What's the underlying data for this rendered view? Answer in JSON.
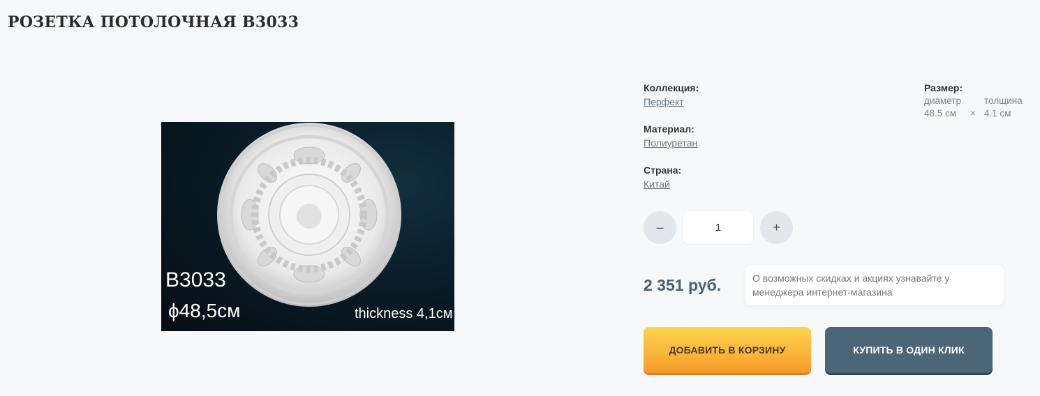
{
  "title": "РОЗЕТКА ПОТОЛОЧНАЯ B3033",
  "image": {
    "code": "B3033",
    "diameter": "ϕ48,5см",
    "thickness": "thickness 4,1см"
  },
  "attributes": [
    {
      "label": "Коллекция:",
      "value": "Перфект"
    },
    {
      "label": "Материал:",
      "value": "Полиуретан"
    },
    {
      "label": "Страна:",
      "value": "Китай"
    }
  ],
  "size": {
    "label": "Размер:",
    "diameter_label": "диаметр",
    "thickness_label": "толщина",
    "diameter_value": "48.5 см",
    "separator": "×",
    "thickness_value": "4.1 см"
  },
  "quantity": {
    "minus": "–",
    "value": "1",
    "plus": "+"
  },
  "price": "2 351 руб.",
  "note": "О возможных скидках и акциях узнавайте у менеджера интернет-магазина",
  "buttons": {
    "add_to_cart": "ДОБАВИТЬ В КОРЗИНУ",
    "buy_one_click": "КУПИТЬ В ОДИН КЛИК"
  },
  "colors": {
    "price": "#46606f",
    "cart_button": "#fbb73a",
    "buy_button": "#4b6677"
  }
}
